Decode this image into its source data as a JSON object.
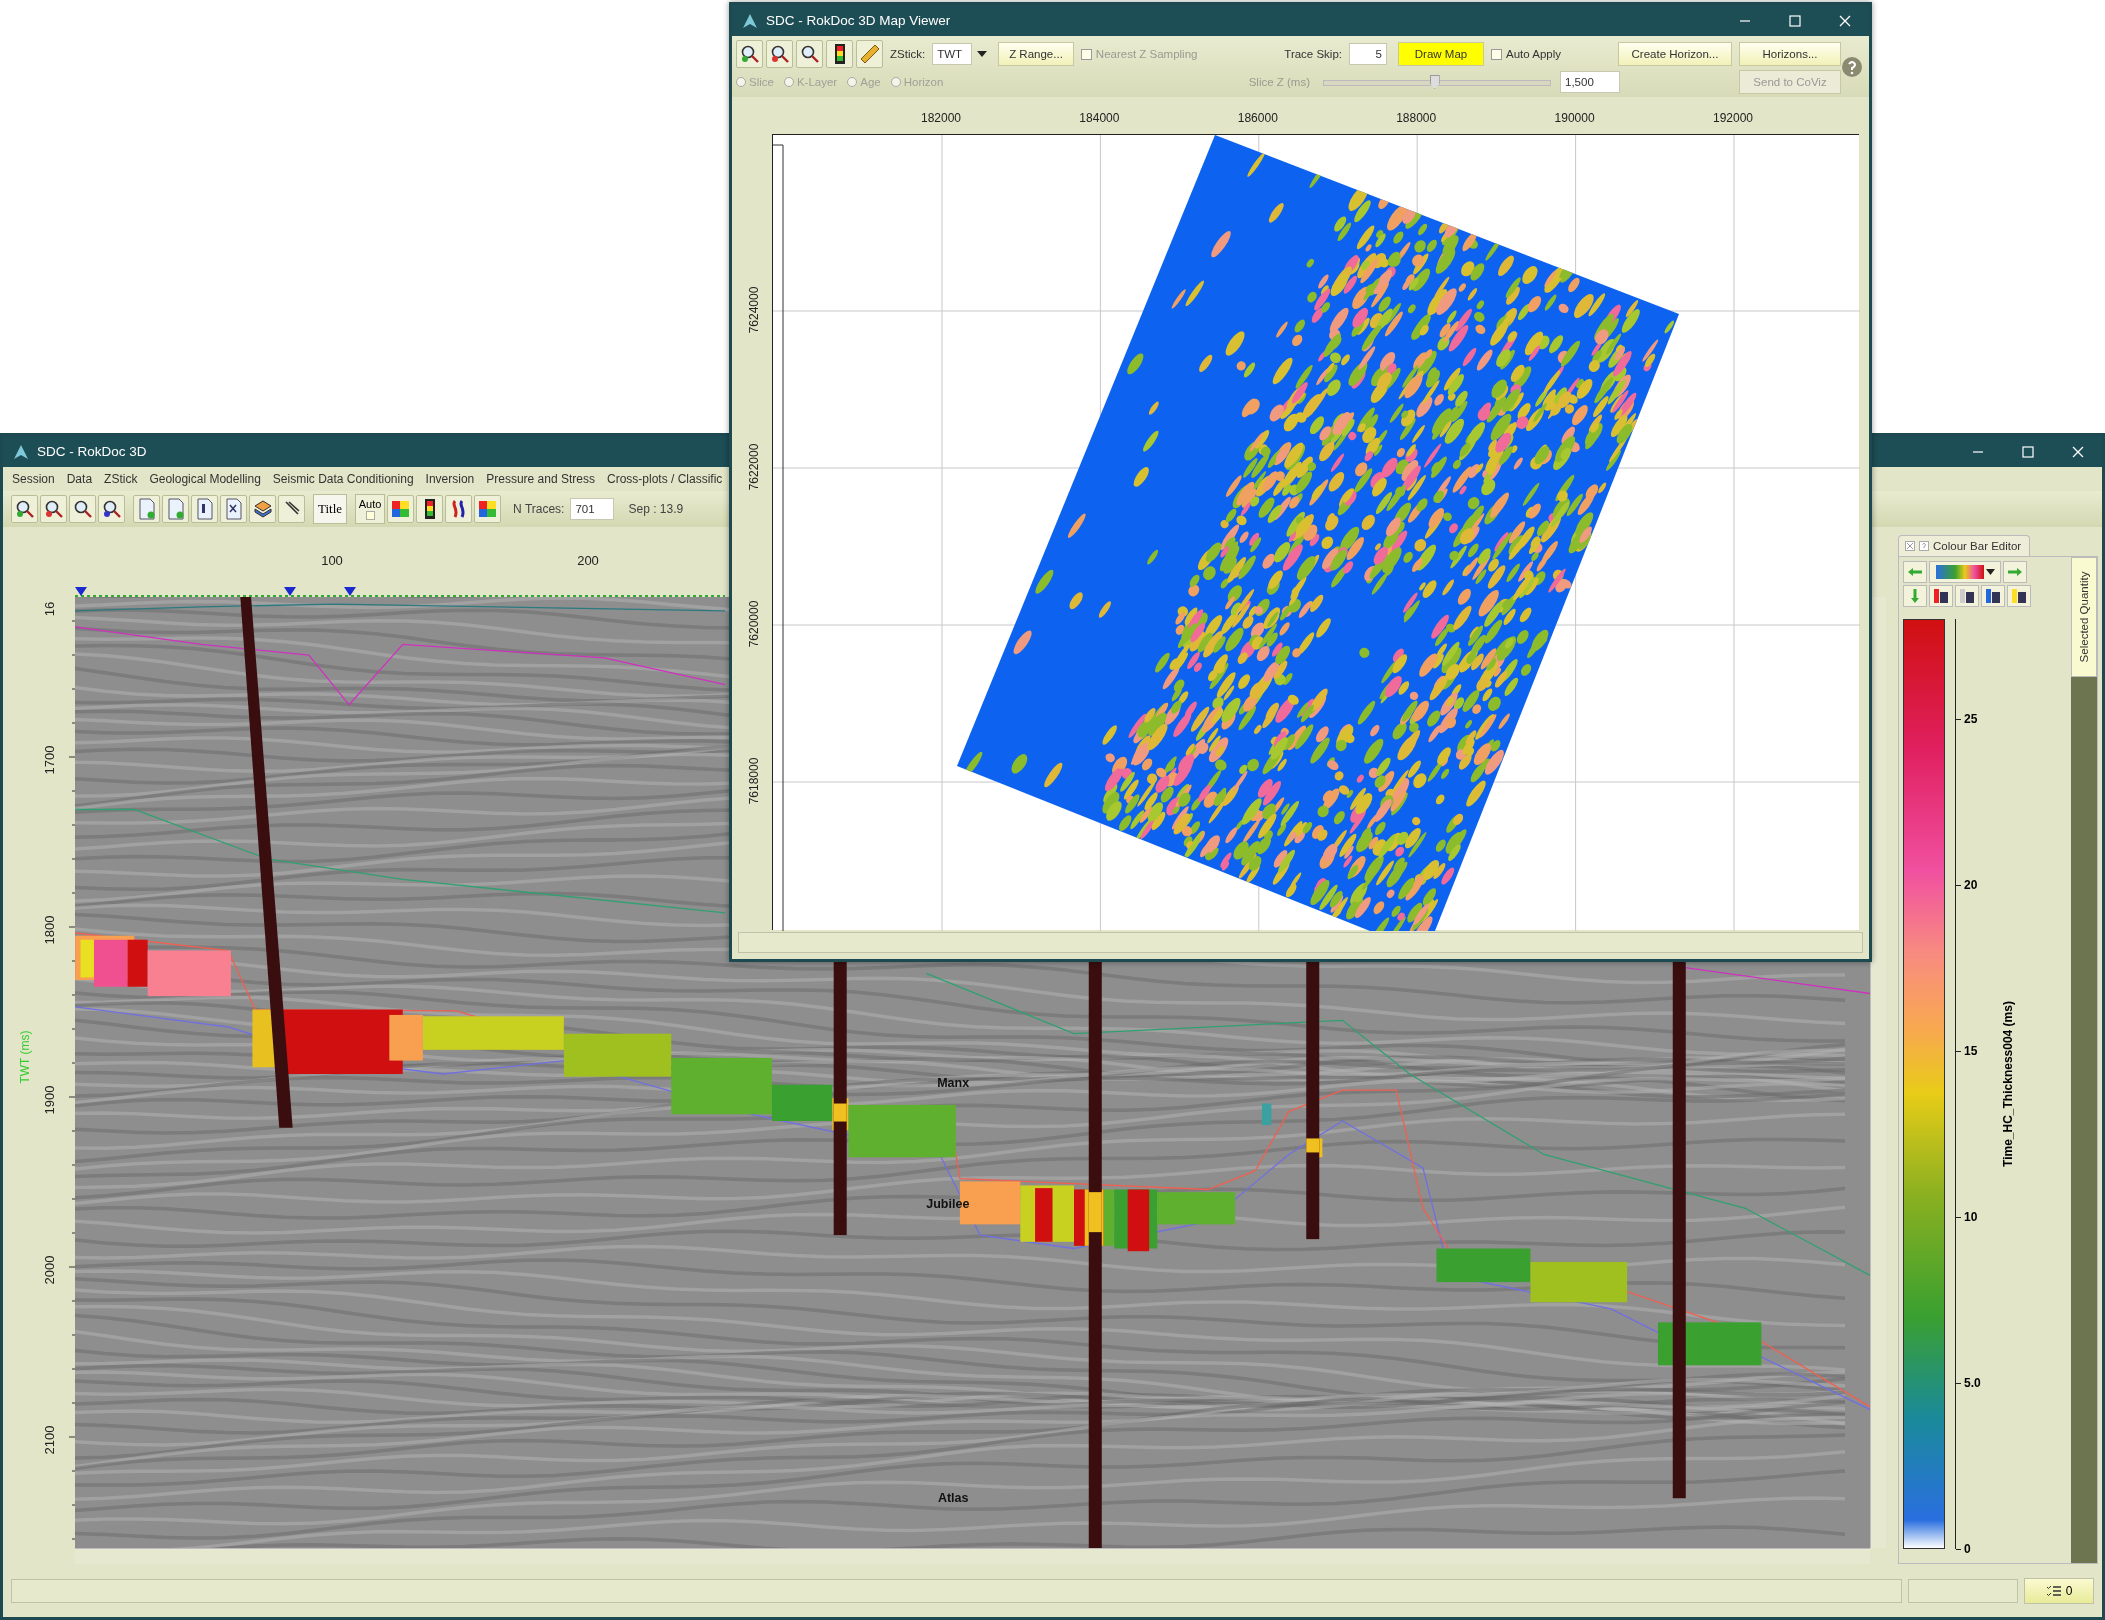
{
  "main_window": {
    "title": "SDC - RokDoc 3D",
    "menu": [
      "Session",
      "Data",
      "ZStick",
      "Geological Modelling",
      "Seismic Data Conditioning",
      "Inversion",
      "Pressure and Stress",
      "Cross-plots / Classific"
    ],
    "toolbar": {
      "title_button": "Title",
      "auto": {
        "label": "Auto",
        "checked": false
      },
      "n_traces_label": "N Traces:",
      "n_traces": "701",
      "separation": "Sep : 13.9"
    },
    "section": {
      "x_ticks": [
        "100",
        "200"
      ],
      "y_ticks": [
        "16",
        "1700",
        "1800",
        "1900",
        "2000",
        "2100"
      ],
      "y_label": "TWT (ms)",
      "horizon_labels": [
        "Manx",
        "Jubilee",
        "Atlas"
      ]
    },
    "colour_bar_editor": {
      "tab": "Colour Bar Editor",
      "side_tab": "Selected Quantity",
      "quantity": "Time_HC_Thickness004 (ms)",
      "ticks": [
        "25",
        "20",
        "15",
        "10",
        "5.0",
        "0"
      ]
    },
    "status_bar": {
      "tasks": "0"
    }
  },
  "map_viewer": {
    "title": "SDC - RokDoc 3D Map Viewer",
    "zstick_label": "ZStick:",
    "zstick": "TWT",
    "z_range_button": "Z Range...",
    "nearest_z": {
      "label": "Nearest Z Sampling",
      "checked": false,
      "disabled": true
    },
    "trace_skip_label": "Trace Skip:",
    "trace_skip": "5",
    "draw_map_button": "Draw Map",
    "auto_apply": {
      "label": "Auto Apply",
      "checked": false
    },
    "create_horizon_button": "Create Horizon...",
    "horizons_button": "Horizons...",
    "modes": [
      {
        "label": "Slice",
        "selected": false,
        "disabled": true
      },
      {
        "label": "K-Layer",
        "selected": false,
        "disabled": true
      },
      {
        "label": "Age",
        "selected": false,
        "disabled": true
      },
      {
        "label": "Horizon",
        "selected": false,
        "disabled": true
      }
    ],
    "slice_z_label": "Slice Z (ms)",
    "slice_z": {
      "level": 0.49,
      "disabled": true
    },
    "slice_z_value": "1,500",
    "send_button": {
      "label": "Send to CoViz",
      "disabled": true
    },
    "x_ticks": [
      "182000",
      "184000",
      "186000",
      "188000",
      "190000",
      "192000"
    ],
    "y_ticks": [
      "7624000",
      "7622000",
      "7620000",
      "7618000"
    ]
  }
}
